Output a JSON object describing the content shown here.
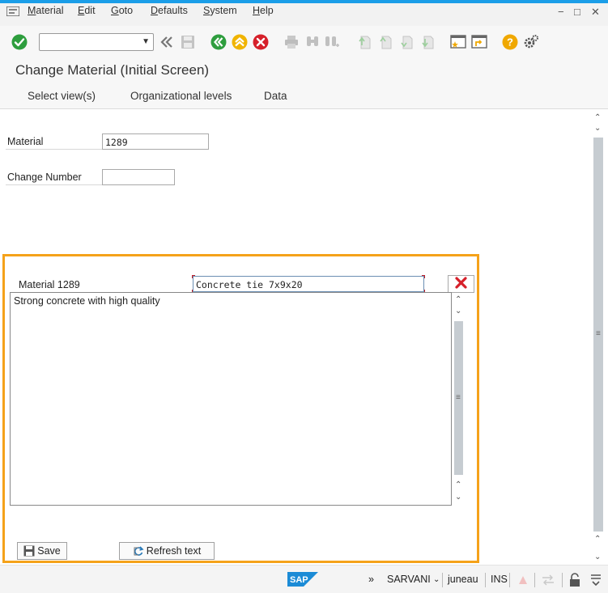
{
  "menu": {
    "items": [
      {
        "first": "M",
        "rest": "aterial"
      },
      {
        "first": "E",
        "rest": "dit"
      },
      {
        "first": "G",
        "rest": "oto"
      },
      {
        "first": "D",
        "rest": "efaults"
      },
      {
        "first": "S",
        "rest": "ystem"
      },
      {
        "first": "H",
        "rest": "elp"
      }
    ]
  },
  "window": {
    "minimize": "−",
    "maximize": "□",
    "close": "✕"
  },
  "toolbar": {
    "command_value": ""
  },
  "page": {
    "title": "Change Material (Initial Screen)"
  },
  "appbar": {
    "buttons": [
      "Select view(s)",
      "Organizational levels",
      "Data"
    ]
  },
  "form": {
    "material_label": "Material",
    "material_value": "1289",
    "change_number_label": "Change Number",
    "change_number_value": ""
  },
  "popup": {
    "material_label": "Material 1289",
    "description_value": "Concrete tie 7x9x20",
    "long_text": "Strong concrete with high quality",
    "save_label": "Save",
    "refresh_label": "Refresh text"
  },
  "status": {
    "chevrons": "»",
    "system": "SARVANI",
    "client": "juneau",
    "mode": "INS"
  },
  "colors": {
    "accent_blue": "#1b9ee8",
    "popup_border": "#f5a21a",
    "ok_green": "#2e9e3e",
    "exit_yellow": "#f0b400",
    "cancel_red": "#d6202a",
    "help_orange": "#f0a800"
  }
}
